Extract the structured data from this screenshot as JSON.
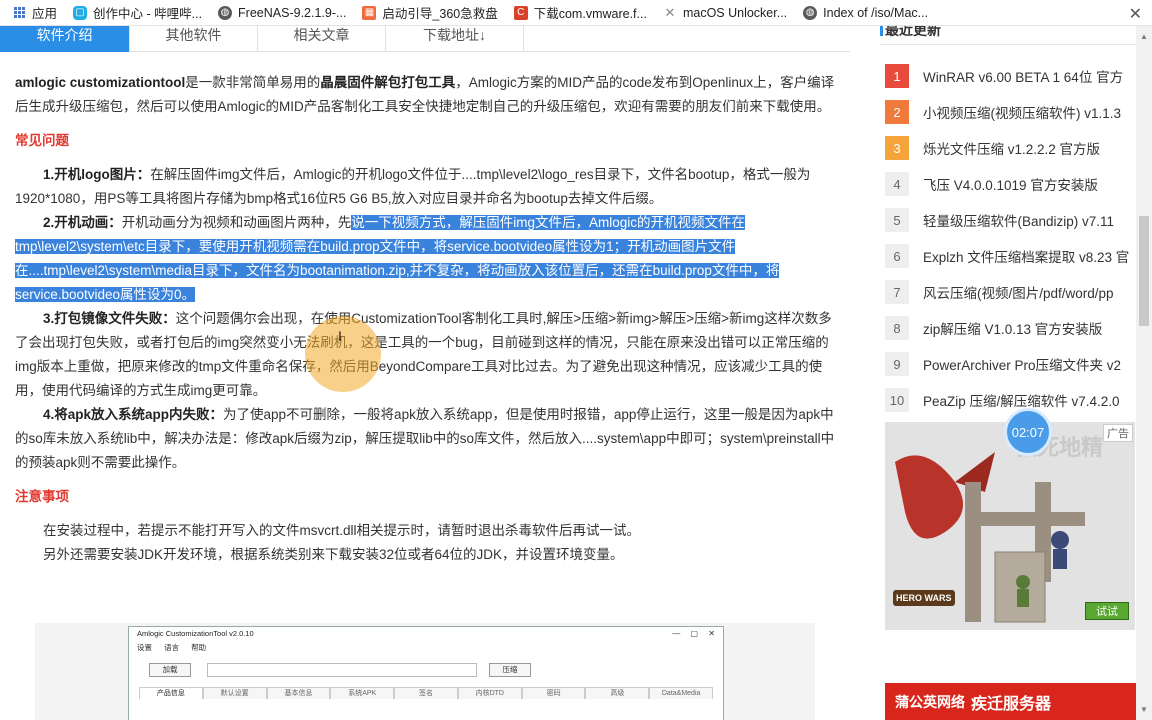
{
  "bookmarks": {
    "items": [
      {
        "label": "应用",
        "icon": "apps-icon"
      },
      {
        "label": "创作中心 - 哔哩哔...",
        "icon": "bilibili-icon"
      },
      {
        "label": "FreeNAS-9.2.1.9-...",
        "icon": "globe-icon"
      },
      {
        "label": "启动引导_360急救盘",
        "icon": "360-icon"
      },
      {
        "label": "下载com.vmware.f...",
        "icon": "c-icon"
      },
      {
        "label": "macOS Unlocker...",
        "icon": "x-icon"
      },
      {
        "label": "Index of /iso/Mac...",
        "icon": "globe-icon"
      }
    ]
  },
  "tabs": [
    {
      "label": "软件介绍"
    },
    {
      "label": "其他软件"
    },
    {
      "label": "相关文章"
    },
    {
      "label": "下载地址↓"
    }
  ],
  "article": {
    "intro_bold1": "amlogic customizationtool",
    "intro_text1": "是一款非常简单易用的",
    "intro_bold2": "晶晨固件解包打包工具",
    "intro_text2": "，Amlogic方案的MID产品的code发布到Openlinux上，客户编译后生成升级压缩包，然后可以使用Amlogic的MID产品客制化工具安全快捷地定制自己的升级压缩包，欢迎有需要的朋友们前来下载使用。",
    "faq_heading": "常见问题",
    "item1_title": "1.开机logo图片：",
    "item1_text": "在解压固件img文件后，Amlogic的开机logo文件位于....tmp\\level2\\logo_res目录下，文件名bootup，格式一般为1920*1080，用PS等工具将图片存储为bmp格式16位R5 G6 B5,放入对应目录并命名为bootup去掉文件后缀。",
    "item2_title": "2.开机动画：",
    "item2_text_plain": "开机动画分为视频和动画图片两种，先",
    "item2_text_hl": "说一下视频方式，解压固件img文件后，Amlogic的开机视频文件在tmp\\level2\\system\\etc目录下，要使用开机视频需在build.prop文件中，将service.bootvideo属性设为1；开机动画图片文件在....tmp\\level2\\system\\media目录下，文件名为bootanimation.zip,并不复杂，将动画放入该位置后，还需在build.prop文件中，将service.bootvideo属性设为0。",
    "item3_title": "3.打包镜像文件失败：",
    "item3_text": "这个问题偶尔会出现，在使用CustomizationTool客制化工具时,解压>压缩>新img>解压>压缩>新img这样次数多了会出现打包失败，或者打包后的img突然变小无法刷机，这是工具的一个bug，目前碰到这样的情况，只能在原来没出错可以正常压缩的img版本上重做，把原来修改的tmp文件重命名保存，然后用BeyondCompare工具对比过去。为了避免出现这种情况，应该减少工具的使用，使用代码编译的方式生成img更可靠。",
    "item4_title": "4.将apk放入系统app内失败：",
    "item4_text": "为了使app不可删除，一般将apk放入系统app，但是使用时报错，app停止运行，这里一般是因为apk中的so库未放入系统lib中，解决办法是：修改apk后缀为zip，解压提取lib中的so库文件，然后放入....system\\app中即可；system\\preinstall中的预装apk则不需要此操作。",
    "notes_heading": "注意事项",
    "note1": "在安装过程中，若提示不能打开写入的文件msvcrt.dll相关提示时，请暂时退出杀毒软件后再试一试。",
    "note2": "另外还需要安装JDK开发环境，根据系统类别来下载安装32位或者64位的JDK，并设置环境变量。"
  },
  "screenshot": {
    "title": "Amlogic CustomizationTool v2.0.10",
    "menu": [
      "设置",
      "语言",
      "帮助"
    ],
    "load_button": "加载",
    "compress_button": "压缩",
    "tabs": [
      "产品信息",
      "默认设置",
      "基本信息",
      "系统APK",
      "签名",
      "内核DTD",
      "密码",
      "高级",
      "Data&Media"
    ]
  },
  "sidebar": {
    "heading": "最近更新",
    "items": [
      {
        "rank": "1",
        "label": "WinRAR v6.00 BETA 1 64位 官方"
      },
      {
        "rank": "2",
        "label": "小视频压缩(视频压缩软件) v1.1.3"
      },
      {
        "rank": "3",
        "label": "烁光文件压缩 v1.2.2.2 官方版"
      },
      {
        "rank": "4",
        "label": "飞压 V4.0.0.1019 官方安装版"
      },
      {
        "rank": "5",
        "label": "轻量级压缩软件(Bandizip) v7.11"
      },
      {
        "rank": "6",
        "label": "Explzh 文件压缩档案提取 v8.23 官"
      },
      {
        "rank": "7",
        "label": "风云压缩(视频/图片/pdf/word/pp"
      },
      {
        "rank": "8",
        "label": "zip解压缩 V1.0.13 官方安装版"
      },
      {
        "rank": "9",
        "label": "PowerArchiver Pro压缩文件夹 v2"
      },
      {
        "rank": "10",
        "label": "PeaZip 压缩/解压缩软件 v7.4.2.0"
      }
    ],
    "ad_tag": "广告",
    "ad_title": "救死地精",
    "ad_logo": "HERO WARS",
    "ad_button": "试试",
    "timer": "02:07",
    "banner_logo": "蒲公英网络",
    "banner_text": "疾迁服务器"
  }
}
